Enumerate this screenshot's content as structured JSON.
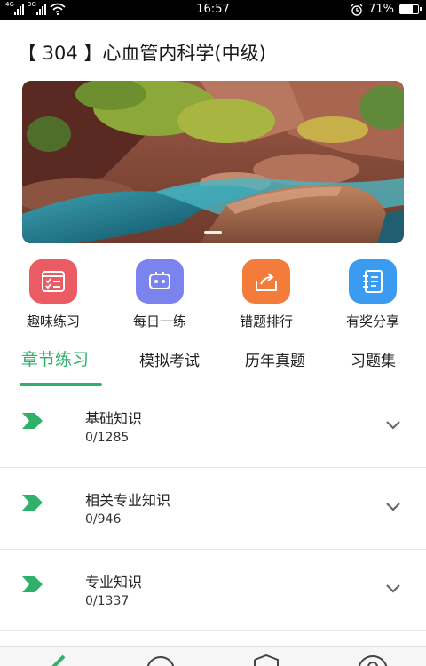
{
  "status_bar": {
    "network_1": "4G",
    "network_2": "3G",
    "time": "16:57",
    "battery_percent": "71%",
    "battery_level": 0.71
  },
  "page": {
    "title": "【 304 】心血管内科学(中级)"
  },
  "banner": {
    "image": "canyon-river-landscape",
    "slide_count": 1,
    "active_slide": 1
  },
  "shortcuts": [
    {
      "label": "趣味练习",
      "icon": "checklist-icon",
      "color": "#ea5b63"
    },
    {
      "label": "每日一练",
      "icon": "robot-icon",
      "color": "#7b83ef"
    },
    {
      "label": "错题排行",
      "icon": "share-box-icon",
      "color": "#f47c3a"
    },
    {
      "label": "有奖分享",
      "icon": "notebook-icon",
      "color": "#3a9bf0"
    }
  ],
  "tabs": [
    {
      "label": "章节练习",
      "active": true
    },
    {
      "label": "模拟考试",
      "active": false
    },
    {
      "label": "历年真题",
      "active": false
    },
    {
      "label": "习题集",
      "active": false
    }
  ],
  "chapters": [
    {
      "name": "基础知识",
      "progress": "0/1285"
    },
    {
      "name": "相关专业知识",
      "progress": "0/946"
    },
    {
      "name": "专业知识",
      "progress": "0/1337"
    }
  ],
  "colors": {
    "accent": "#2fb169",
    "divider": "#e6e6e6",
    "chevron": "#666666"
  },
  "bottom_nav": {
    "icons": [
      "pencil-icon",
      "chat-icon",
      "shield-icon",
      "user-icon"
    ]
  }
}
